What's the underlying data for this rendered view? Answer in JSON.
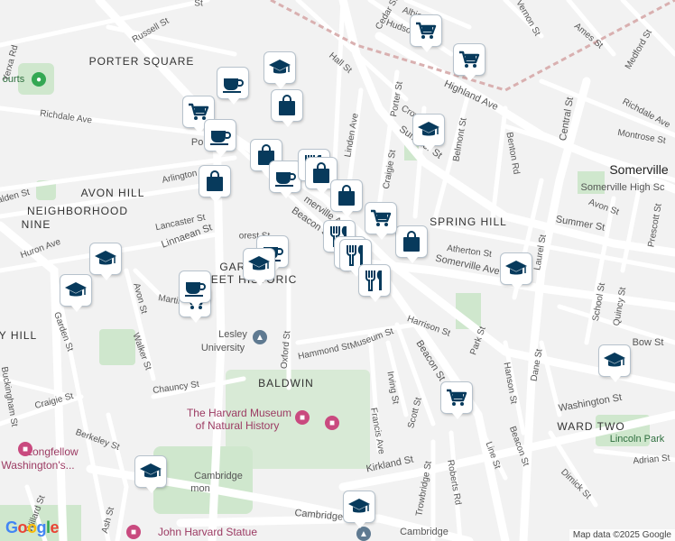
{
  "map": {
    "attribution": "Map data ©2025 Google",
    "logo": "Google"
  },
  "neighborhoods": [
    {
      "id": "porter-square",
      "text": "PORTER SQUARE"
    },
    {
      "id": "avon-hill",
      "text": "AVON HILL"
    },
    {
      "id": "neighborhood-nine-1",
      "text": "NEIGHBORHOOD"
    },
    {
      "id": "neighborhood-nine-2",
      "text": "NINE"
    },
    {
      "id": "spring-hill",
      "text": "SPRING HILL"
    },
    {
      "id": "baldwin",
      "text": "BALDWIN"
    },
    {
      "id": "ward-two",
      "text": "WARD TWO"
    },
    {
      "id": "garden-street",
      "text": "GARDEN"
    },
    {
      "id": "garden-street-2",
      "text": "STREET HISTORIC"
    },
    {
      "id": "hill",
      "text": "Y HILL"
    }
  ],
  "places": [
    {
      "id": "somerville",
      "text": "Somerville"
    },
    {
      "id": "somerville-high",
      "text": "Somerville High Sc"
    },
    {
      "id": "lesley",
      "text": "Lesley"
    },
    {
      "id": "lesley-univ",
      "text": "University"
    },
    {
      "id": "harvard-museum-1",
      "text": "The Harvard Museum"
    },
    {
      "id": "harvard-museum-2",
      "text": "of Natural History"
    },
    {
      "id": "longfellow-1",
      "text": "Longfellow"
    },
    {
      "id": "longfellow-2",
      "text": "Washington's..."
    },
    {
      "id": "cambridge-common-1",
      "text": "Cambridge"
    },
    {
      "id": "cambridge-common-2",
      "text": "mon"
    },
    {
      "id": "john-harvard",
      "text": "John Harvard Statue"
    },
    {
      "id": "lincoln-park",
      "text": "Lincoln Park"
    },
    {
      "id": "cambridge-bottom",
      "text": "Cambridge"
    },
    {
      "id": "courts",
      "text": "ourts"
    },
    {
      "id": "porter",
      "text": "Port"
    }
  ],
  "streets": [
    {
      "id": "russell",
      "text": "Russell St"
    },
    {
      "id": "yerxa",
      "text": "Yerxa Rd"
    },
    {
      "id": "richdale",
      "text": "Richdale Ave"
    },
    {
      "id": "hall",
      "text": "Hall St"
    },
    {
      "id": "cedar",
      "text": "Cedar St"
    },
    {
      "id": "albion",
      "text": "Albion St"
    },
    {
      "id": "hudson",
      "text": "Hudson St"
    },
    {
      "id": "vernon",
      "text": "Vernon St"
    },
    {
      "id": "ames",
      "text": "Ames St"
    },
    {
      "id": "medford",
      "text": "Medford St"
    },
    {
      "id": "highland",
      "text": "Highland Ave"
    },
    {
      "id": "porter-st",
      "text": "Porter St"
    },
    {
      "id": "crown",
      "text": "Crown St"
    },
    {
      "id": "linden",
      "text": "Linden Ave"
    },
    {
      "id": "summer",
      "text": "Summer St"
    },
    {
      "id": "summer-2",
      "text": "Summer St"
    },
    {
      "id": "central",
      "text": "Central St"
    },
    {
      "id": "richdale-2",
      "text": "Richdale Ave"
    },
    {
      "id": "montrose",
      "text": "Montrose St"
    },
    {
      "id": "benton",
      "text": "Benton Rd"
    },
    {
      "id": "craigie",
      "text": "Craigie St"
    },
    {
      "id": "belmont",
      "text": "Belmont St"
    },
    {
      "id": "arlington",
      "text": "Arlington St"
    },
    {
      "id": "lancaster",
      "text": "Lancaster St"
    },
    {
      "id": "linnaean",
      "text": "Linnaean St"
    },
    {
      "id": "huron",
      "text": "Huron Ave"
    },
    {
      "id": "walden",
      "text": "alden St"
    },
    {
      "id": "forest",
      "text": "orest St"
    },
    {
      "id": "beacon",
      "text": "Beacon St"
    },
    {
      "id": "somerville-ave",
      "text": "merville Ave"
    },
    {
      "id": "somerville-ave-2",
      "text": "Somerville Ave"
    },
    {
      "id": "atherton",
      "text": "Atherton St"
    },
    {
      "id": "avon-st",
      "text": "Avon St"
    },
    {
      "id": "laurel",
      "text": "Laurel St"
    },
    {
      "id": "prescott",
      "text": "Prescott St"
    },
    {
      "id": "quincy",
      "text": "Quincy St"
    },
    {
      "id": "school",
      "text": "School St"
    },
    {
      "id": "bow",
      "text": "Bow St"
    },
    {
      "id": "avon-2",
      "text": "Avon St"
    },
    {
      "id": "martin",
      "text": "Martin St"
    },
    {
      "id": "garden",
      "text": "Garden St"
    },
    {
      "id": "walker",
      "text": "Walker St"
    },
    {
      "id": "oxford",
      "text": "Oxford St"
    },
    {
      "id": "hammond",
      "text": "Hammond St"
    },
    {
      "id": "museum",
      "text": "Museum St"
    },
    {
      "id": "harrison",
      "text": "Harrison St"
    },
    {
      "id": "beacon-2",
      "text": "Beacon St"
    },
    {
      "id": "park",
      "text": "Park St"
    },
    {
      "id": "dane",
      "text": "Dane St"
    },
    {
      "id": "hanson",
      "text": "Hanson St"
    },
    {
      "id": "chauncy",
      "text": "Chauncy St"
    },
    {
      "id": "craigie-2",
      "text": "Craigie St"
    },
    {
      "id": "buckingham",
      "text": "Buckingham St"
    },
    {
      "id": "berkeley",
      "text": "Berkeley St"
    },
    {
      "id": "irving",
      "text": "Irving St"
    },
    {
      "id": "scott",
      "text": "Scott St"
    },
    {
      "id": "francis",
      "text": "Francis Ave"
    },
    {
      "id": "washington",
      "text": "Washington St"
    },
    {
      "id": "beacon-3",
      "text": "Beacon St"
    },
    {
      "id": "line",
      "text": "Line St"
    },
    {
      "id": "kirkland",
      "text": "Kirkland St"
    },
    {
      "id": "trowbridge",
      "text": "Trowbridge St"
    },
    {
      "id": "roberts",
      "text": "Roberts Rd"
    },
    {
      "id": "dimick",
      "text": "Dimick St"
    },
    {
      "id": "adrian",
      "text": "Adrian St"
    },
    {
      "id": "willard",
      "text": "Willard St"
    },
    {
      "id": "ash",
      "text": "Ash St"
    },
    {
      "id": "cambridge-st",
      "text": "Cambridge St"
    },
    {
      "id": "sacramento",
      "text": "St"
    }
  ],
  "pins": [
    {
      "type": "grocery",
      "icon": "shopping-cart-icon"
    },
    {
      "type": "grocery",
      "icon": "shopping-cart-icon"
    },
    {
      "type": "school",
      "icon": "graduation-cap-icon"
    },
    {
      "type": "shopping",
      "icon": "shopping-bag-icon"
    },
    {
      "type": "cafe",
      "icon": "coffee-cup-icon"
    },
    {
      "type": "grocery",
      "icon": "shopping-cart-icon"
    },
    {
      "type": "cafe",
      "icon": "coffee-cup-icon"
    },
    {
      "type": "school",
      "icon": "graduation-cap-icon"
    },
    {
      "type": "shopping",
      "icon": "shopping-bag-icon"
    },
    {
      "type": "cafe",
      "icon": "coffee-cup-icon"
    },
    {
      "type": "shopping",
      "icon": "shopping-bag-icon"
    },
    {
      "type": "restaurant",
      "icon": "fork-knife-icon"
    },
    {
      "type": "shopping",
      "icon": "shopping-bag-icon"
    },
    {
      "type": "shopping",
      "icon": "shopping-bag-icon"
    },
    {
      "type": "restaurant",
      "icon": "fork-knife-icon"
    },
    {
      "type": "restaurant",
      "icon": "fork-knife-icon"
    },
    {
      "type": "shopping",
      "icon": "shopping-bag-icon"
    },
    {
      "type": "cafe",
      "icon": "coffee-cup-icon"
    },
    {
      "type": "school",
      "icon": "graduation-cap-icon"
    },
    {
      "type": "school",
      "icon": "graduation-cap-icon"
    },
    {
      "type": "school",
      "icon": "graduation-cap-icon"
    },
    {
      "type": "grocery",
      "icon": "shopping-cart-icon"
    },
    {
      "type": "restaurant",
      "icon": "fork-knife-icon"
    },
    {
      "type": "restaurant",
      "icon": "fork-knife-icon"
    },
    {
      "type": "school",
      "icon": "graduation-cap-icon"
    },
    {
      "type": "grocery",
      "icon": "shopping-cart-icon"
    },
    {
      "type": "school",
      "icon": "graduation-cap-icon"
    },
    {
      "type": "school",
      "icon": "graduation-cap-icon"
    },
    {
      "type": "school",
      "icon": "graduation-cap-icon"
    },
    {
      "type": "cafe",
      "icon": "coffee-cup-icon"
    },
    {
      "type": "grocery",
      "icon": "shopping-cart-icon"
    }
  ],
  "colors": {
    "pin_icon": "#073a5c",
    "road": "#ffffff",
    "major_road": "#ffffff",
    "park": "#c8e6c9",
    "background": "#f2f2f2",
    "rail": "#c98b8b"
  }
}
